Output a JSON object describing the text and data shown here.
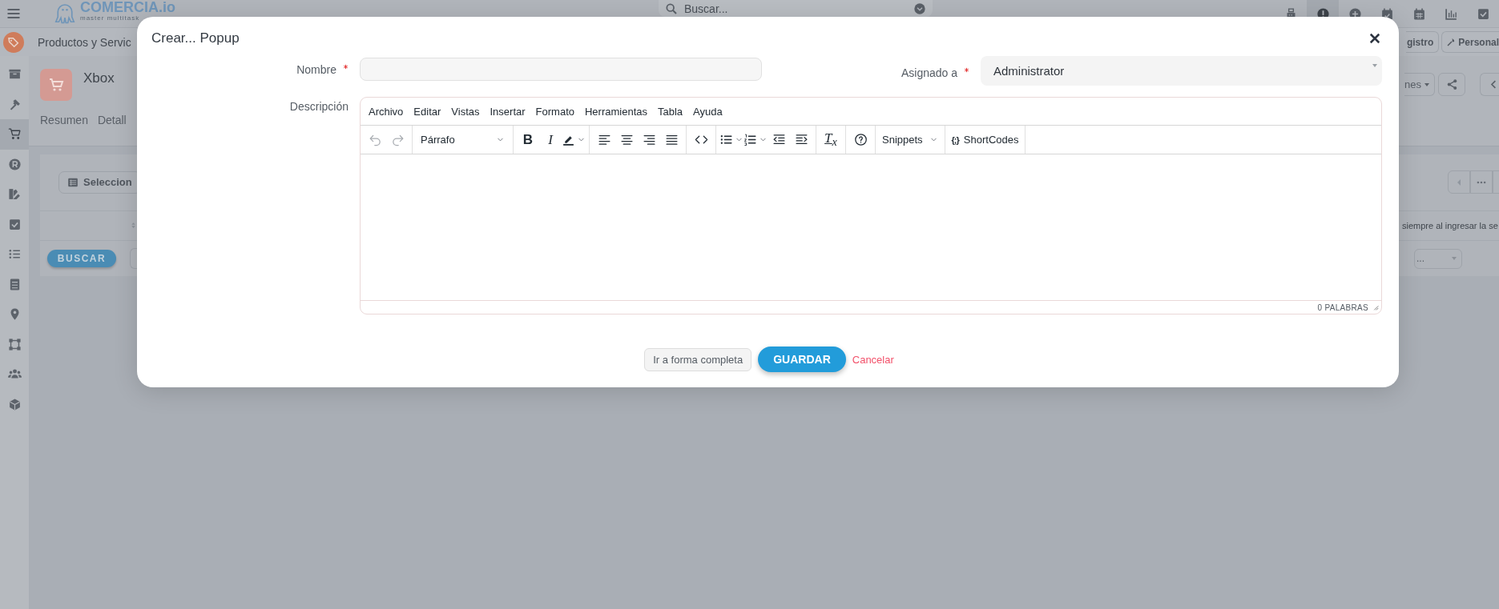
{
  "app": {
    "logo": {
      "name": "COMERCIA.io",
      "tagline": "master multitask"
    },
    "search": {
      "placeholder": "Buscar..."
    },
    "topbar_icons": [
      {
        "kind": "register",
        "selected": false
      },
      {
        "kind": "alert",
        "selected": true
      },
      {
        "kind": "add",
        "selected": false
      },
      {
        "kind": "calendar-check",
        "selected": false
      },
      {
        "kind": "calendar",
        "selected": false
      },
      {
        "kind": "chart",
        "selected": false
      },
      {
        "kind": "checkbox",
        "selected": false
      }
    ],
    "module": {
      "title": "Productos y Servic"
    },
    "header_buttons": [
      {
        "kind": "text",
        "label": "gistro"
      },
      {
        "kind": "wrench",
        "label": "Personal"
      }
    ],
    "sidebar": [
      {
        "kind": "box",
        "selected": false
      },
      {
        "kind": "hammer",
        "selected": false
      },
      {
        "kind": "cart",
        "selected": true
      },
      {
        "kind": "r",
        "selected": false
      },
      {
        "kind": "palette",
        "selected": false
      },
      {
        "kind": "check",
        "selected": false
      },
      {
        "kind": "list",
        "selected": false
      },
      {
        "kind": "cabinet",
        "selected": false
      },
      {
        "kind": "pin",
        "selected": false
      },
      {
        "kind": "vector",
        "selected": false
      },
      {
        "kind": "users",
        "selected": false
      },
      {
        "kind": "cube",
        "selected": false
      }
    ],
    "record": {
      "title": "Xbox"
    },
    "tabs": [
      "Resumen",
      "Detall"
    ],
    "actions_button": "nes",
    "select_columns_button": "Seleccion",
    "search_button": "BUSCAR",
    "note": "siempre al ingresar la se",
    "filter_select": "..."
  },
  "modal": {
    "title": "Crear... Popup",
    "fields": {
      "name": {
        "label": "Nombre",
        "required": true
      },
      "assigned": {
        "label": "Asignado a",
        "required": true,
        "value": "Administrator"
      },
      "description": {
        "label": "Descripción"
      }
    },
    "editor": {
      "menu": [
        "Archivo",
        "Editar",
        "Vistas",
        "Insertar",
        "Formato",
        "Herramientas",
        "Tabla",
        "Ayuda"
      ],
      "toolbar": [
        [
          {
            "kind": "undo",
            "disabled": true
          },
          {
            "kind": "redo",
            "disabled": true
          }
        ],
        [
          {
            "kind": "select",
            "label": "Párrafo",
            "disabled": false
          }
        ],
        [
          {
            "kind": "bold",
            "label": "B",
            "disabled": false
          },
          {
            "kind": "italic",
            "label": "I",
            "disabled": false
          },
          {
            "kind": "highlight",
            "disabled": false
          }
        ],
        [
          {
            "kind": "align-left",
            "disabled": false
          },
          {
            "kind": "align-center",
            "disabled": false
          },
          {
            "kind": "align-right",
            "disabled": false
          },
          {
            "kind": "justify",
            "disabled": false
          }
        ],
        [
          {
            "kind": "code",
            "disabled": false
          }
        ],
        [
          {
            "kind": "bullets",
            "disabled": false
          },
          {
            "kind": "numbers",
            "disabled": false
          },
          {
            "kind": "outdent",
            "disabled": false
          },
          {
            "kind": "indent",
            "disabled": false
          }
        ],
        [
          {
            "kind": "clear",
            "label": "T$_{x}$",
            "disabled": false
          }
        ],
        [
          {
            "kind": "help",
            "disabled": false
          }
        ],
        [
          {
            "kind": "dropdown",
            "label": "Snippets",
            "disabled": false
          }
        ],
        [
          {
            "kind": "shortcodes",
            "icon": "{;}",
            "label": "ShortCodes",
            "disabled": false
          }
        ]
      ],
      "word_count": "0 PALABRAS"
    },
    "buttons": [
      {
        "kind": "secondary",
        "label": "Ir a forma completa"
      },
      {
        "kind": "primary",
        "label": "GUARDAR"
      },
      {
        "kind": "link",
        "label": "Cancelar"
      }
    ]
  }
}
